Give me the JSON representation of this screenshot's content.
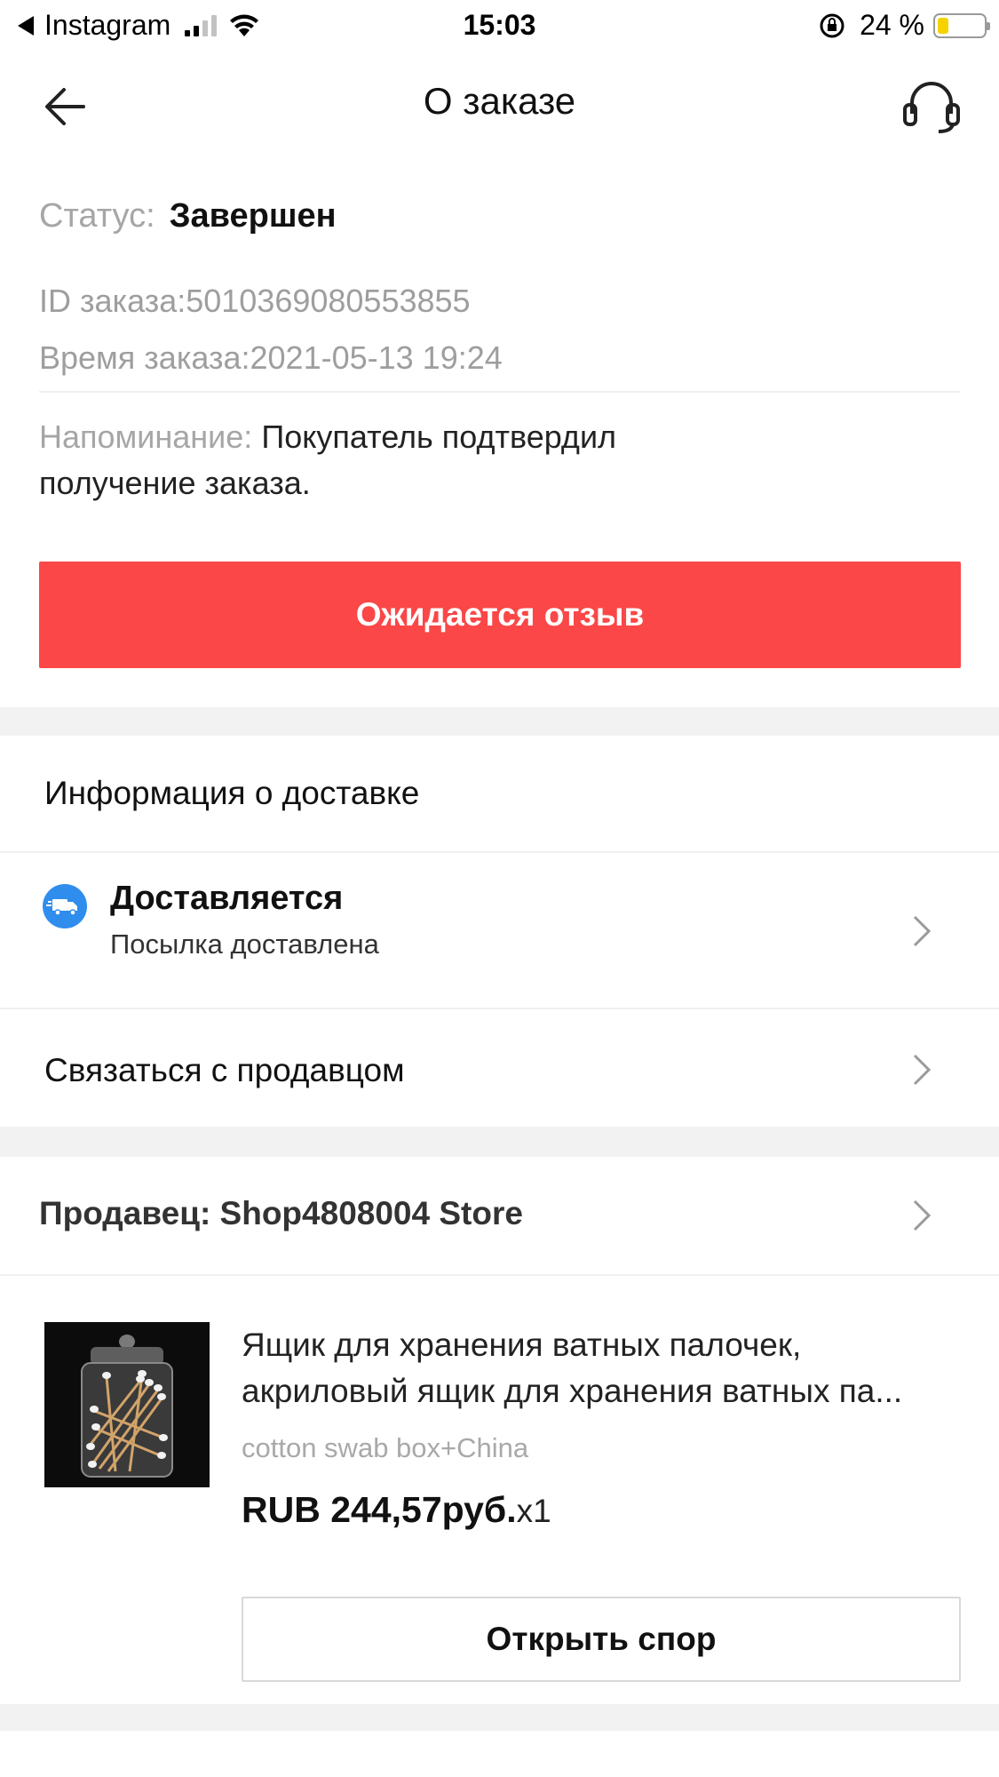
{
  "status_bar": {
    "back_app": "Instagram",
    "time": "15:03",
    "battery_percent": "24 %",
    "battery_level": 0.24,
    "battery_color": "#f5d300"
  },
  "nav": {
    "title": "О заказе",
    "back_icon": "arrow-left-icon",
    "support_icon": "headset-icon"
  },
  "order": {
    "status_label": "Статус:",
    "status_value": "Завершен",
    "id_text": "ID заказа:5010369080553855",
    "time_text": "Время заказа:2021-05-13 19:24",
    "reminder_label": "Напоминание:",
    "reminder_line1": "Покупатель подтвердил",
    "reminder_line2": "получение заказа.",
    "review_button": "Ожидается отзыв",
    "accent_color": "#fb4747"
  },
  "delivery": {
    "section_title": "Информация о доставке",
    "status_title": "Доставляется",
    "status_sub": "Посылка доставлена",
    "icon": "truck-icon",
    "icon_color": "#2f8ded",
    "contact_seller": "Связаться с продавцом"
  },
  "seller": {
    "label": "Продавец: Shop4808004 Store"
  },
  "product": {
    "title_line1": "Ящик для хранения ватных палочек,",
    "title_line2": "акриловый ящик для хранения ватных па...",
    "variant": "cotton swab box+China",
    "price": "RUB 244,57руб.",
    "quantity": "x1",
    "dispute_button": "Открыть спор"
  }
}
